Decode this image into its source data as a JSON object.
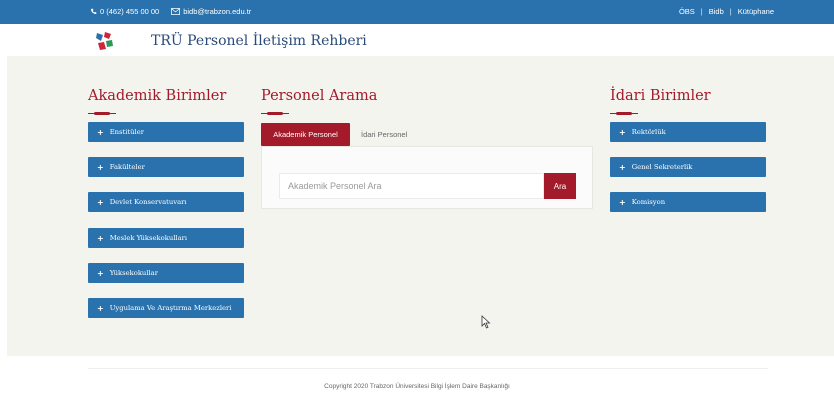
{
  "topbar": {
    "phone": "0 (462) 455 00 00",
    "email": "bidb@trabzon.edu.tr",
    "links": [
      "ÖBS",
      "Bidb",
      "Kütüphane"
    ],
    "separator": "|"
  },
  "header": {
    "title": "TRÜ Personel İletişim Rehberi"
  },
  "academic": {
    "title": "Akademik Birimler",
    "items": [
      {
        "label": "Enstitüler"
      },
      {
        "label": "Fakülteler"
      },
      {
        "label": "Devlet Konservatuvarı"
      },
      {
        "label": "Meslek Yüksekokulları"
      },
      {
        "label": "Yüksekokullar"
      },
      {
        "label": "Uygulama Ve Araştırma Merkezleri"
      }
    ]
  },
  "search": {
    "title": "Personel Arama",
    "tabs": [
      {
        "label": "Akademik Personel",
        "active": true
      },
      {
        "label": "İdari Personel",
        "active": false
      }
    ],
    "placeholder": "Akademik Personel Ara",
    "button_label": "Ara"
  },
  "admin": {
    "title": "İdari Birimler",
    "items": [
      {
        "label": "Rektörlük"
      },
      {
        "label": "Genel Sekreterlik"
      },
      {
        "label": "Komisyon"
      }
    ]
  },
  "footer": {
    "copyright": "Copyright 2020 Trabzon Üniversitesi Bilgi İşlem Daire Başkanlığı"
  },
  "colors": {
    "primary_blue": "#2a72ad",
    "accent_red": "#a31a2b"
  }
}
